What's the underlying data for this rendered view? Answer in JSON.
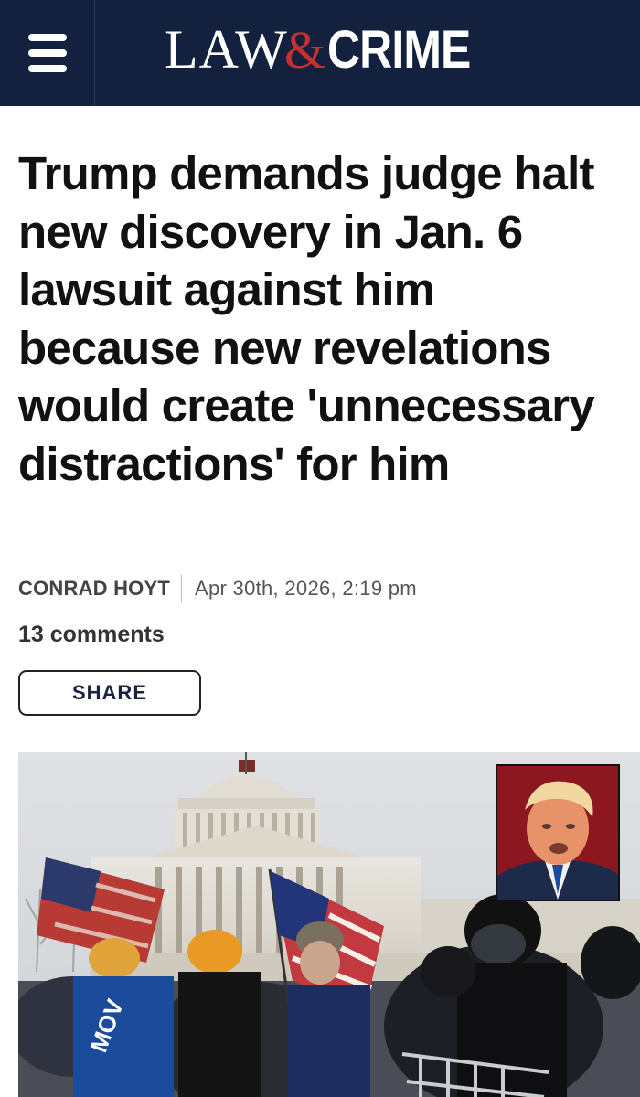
{
  "header": {
    "brand_left": "LAW",
    "brand_amp": "&",
    "brand_right": "CRIME",
    "menu_icon": "hamburger-menu-icon"
  },
  "article": {
    "headline": "Trump demands judge halt new discovery in Jan. 6 lawsuit against him because new revelations would create 'unnecessary distractions' for him",
    "author": "CONRAD HOYT",
    "date": "Apr 30th, 2026, 2:19 pm",
    "comments": "13 comments",
    "share_label": "SHARE"
  },
  "colors": {
    "header_bg": "#13213f",
    "brand_accent": "#c42f2f",
    "text_primary": "#111111"
  }
}
